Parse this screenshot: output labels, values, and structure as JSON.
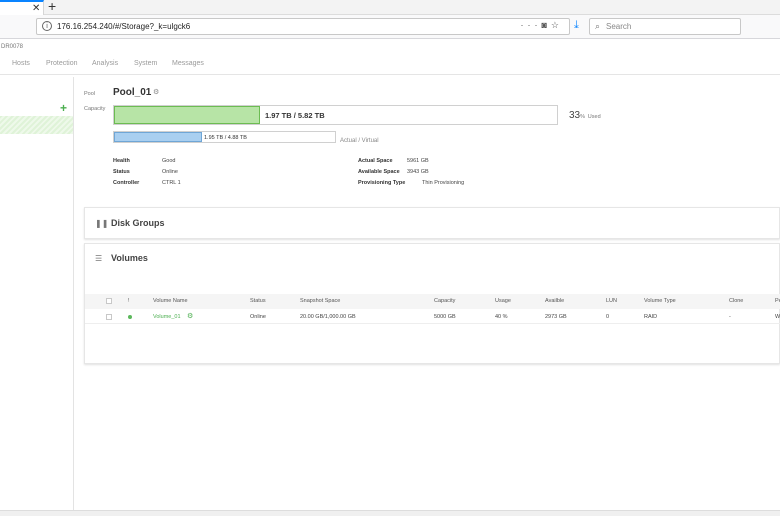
{
  "browser": {
    "url": "176.16.254.240/#/Storage?_k=ulgck6",
    "search_placeholder": "Search",
    "icons": [
      "close-icon",
      "new-tab-icon",
      "info-icon",
      "pocket-icon",
      "bookmark-star-icon",
      "download-icon",
      "search-icon"
    ]
  },
  "app": {
    "brand": "DR0078",
    "nav": [
      "Hosts",
      "Protection",
      "Analysis",
      "System",
      "Messages"
    ]
  },
  "pool": {
    "label": "Pool",
    "name": "Pool_01",
    "capacity_label": "Capacity",
    "capacity_text": "1.97 TB / 5.82 TB",
    "capacity_fraction": 0.33,
    "used_pct": "33",
    "used_pct_unit": "%",
    "used_suffix": "Used",
    "virtual_text": "1.95 TB / 4.88 TB",
    "virtual_fraction": 0.4,
    "virtual_label": "Actual / Virtual",
    "details_left": [
      {
        "label": "Health",
        "value": "Good"
      },
      {
        "label": "Status",
        "value": "Online"
      },
      {
        "label": "Controller",
        "value": "CTRL 1"
      }
    ],
    "details_right": [
      {
        "label": "Actual Space",
        "value": "5961 GB"
      },
      {
        "label": "Available Space",
        "value": "3943 GB"
      },
      {
        "label": "Provisioning Type",
        "value": "Thin Provisioning"
      }
    ]
  },
  "disk_groups": {
    "title": "Disk Groups"
  },
  "volumes": {
    "title": "Volumes",
    "columns": [
      "!",
      "Volume Name",
      "Status",
      "Snapshot Space",
      "Capacity",
      "Usage",
      "Availble",
      "LUN",
      "Volume Type",
      "Clone",
      "Pe"
    ],
    "rows": [
      {
        "name": "Volume_01",
        "status": "Online",
        "snapshot": "20.00 GB/1,000.00 GB",
        "capacity": "5000 GB",
        "usage": "40 %",
        "available": "2973 GB",
        "lun": "0",
        "type": "RAID",
        "clone": "-",
        "pe": "W"
      }
    ]
  },
  "colors": {
    "accent_green": "#4caf50",
    "capacity_fill": "#b7e4a6",
    "virtual_fill": "#a9cff0",
    "browser_accent": "#0a84ff"
  }
}
